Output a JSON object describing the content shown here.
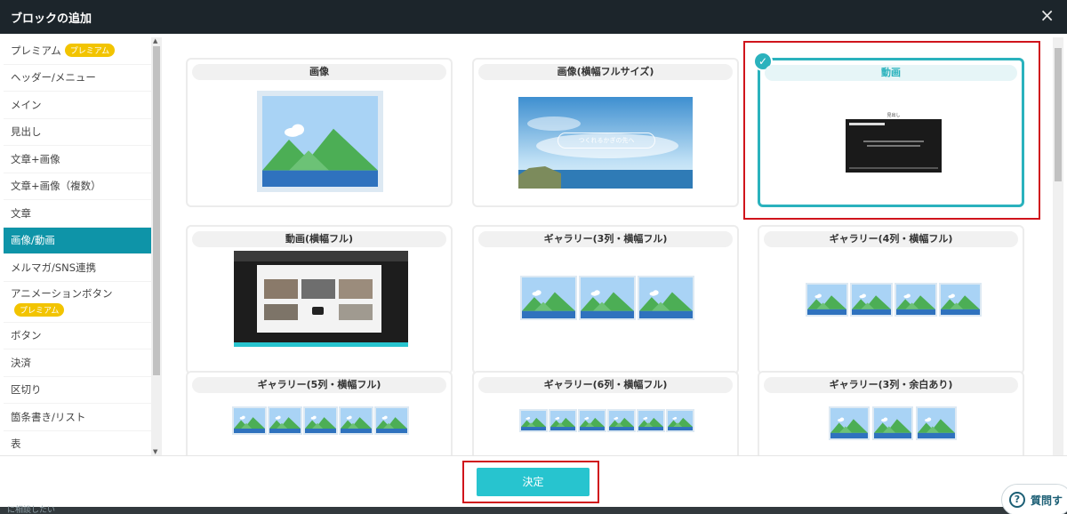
{
  "dialog": {
    "title": "ブロックの追加",
    "close_label": "×",
    "submit_label": "決定"
  },
  "sidebar": {
    "items": [
      {
        "label": "プレミアム",
        "badge": "プレミアム"
      },
      {
        "label": "ヘッダー/メニュー"
      },
      {
        "label": "メイン"
      },
      {
        "label": "見出し"
      },
      {
        "label": "文章+画像"
      },
      {
        "label": "文章+画像（複数）"
      },
      {
        "label": "文章"
      },
      {
        "label": "画像/動画",
        "active": true
      },
      {
        "label": "メルマガ/SNS連携"
      },
      {
        "label": "アニメーションボタン",
        "badge": "プレミアム"
      },
      {
        "label": "ボタン"
      },
      {
        "label": "決済"
      },
      {
        "label": "区切り"
      },
      {
        "label": "箇条書き/リスト"
      },
      {
        "label": "表"
      }
    ]
  },
  "blocks": [
    {
      "title": "画像"
    },
    {
      "title": "画像(横幅フルサイズ)",
      "banner_text": "つくれるかぎの先へ"
    },
    {
      "title": "動画",
      "selected": true,
      "video_heading": "見出し"
    },
    {
      "title": "動画(横幅フル)"
    },
    {
      "title": "ギャラリー(3列・横幅フル)"
    },
    {
      "title": "ギャラリー(4列・横幅フル)"
    },
    {
      "title": "ギャラリー(5列・横幅フル)"
    },
    {
      "title": "ギャラリー(6列・横幅フル)"
    },
    {
      "title": "ギャラリー(3列・余白あり)"
    }
  ],
  "help": {
    "label": "質問す"
  },
  "background": {
    "partial_text": "に相談したい"
  },
  "colors": {
    "accent": "#2ab2bd",
    "active_sidebar": "#0e94a8",
    "highlight": "#d0141c",
    "badge": "#f2c400",
    "header": "#1c252b"
  },
  "icons": {
    "close": "close-icon",
    "check": "check-icon",
    "help": "help-icon"
  }
}
